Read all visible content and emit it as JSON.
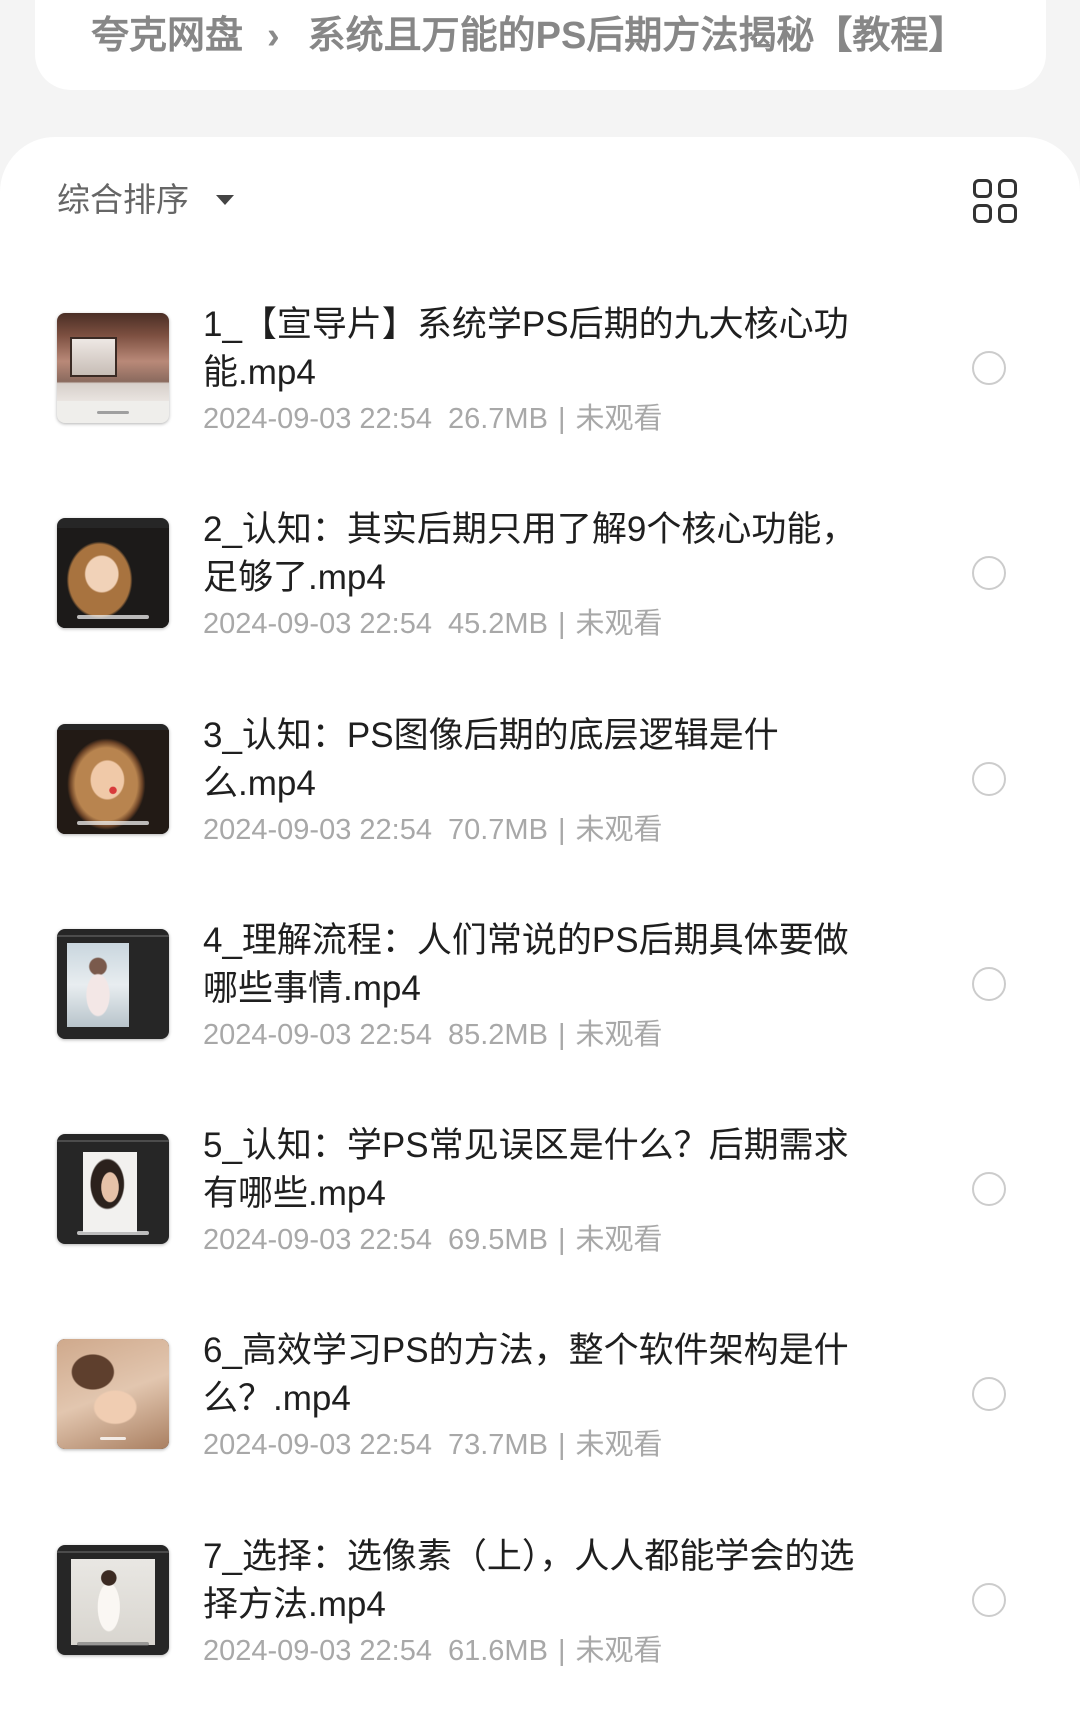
{
  "breadcrumb": {
    "root": "夸克网盘",
    "separator": "›",
    "current": "系统且万能的PS后期方法揭秘【教程】"
  },
  "toolbar": {
    "sort_label": "综合排序",
    "sort_icon": "caret-down-icon",
    "view_toggle_icon": "grid-view-icon"
  },
  "list": {
    "meta_separator": "|",
    "select_icon": "radio-circle-icon"
  },
  "files": [
    {
      "title": "1_【宣导片】系统学PS后期的九大核心功能.mp4",
      "date": "2024-09-03 22:54",
      "size": "26.7MB",
      "status": "未观看"
    },
    {
      "title": "2_认知：其实后期只用了解9个核心功能，足够了.mp4",
      "date": "2024-09-03 22:54",
      "size": "45.2MB",
      "status": "未观看"
    },
    {
      "title": "3_认知：PS图像后期的底层逻辑是什么.mp4",
      "date": "2024-09-03 22:54",
      "size": "70.7MB",
      "status": "未观看"
    },
    {
      "title": "4_理解流程：人们常说的PS后期具体要做哪些事情.mp4",
      "date": "2024-09-03 22:54",
      "size": "85.2MB",
      "status": "未观看"
    },
    {
      "title": "5_认知：学PS常见误区是什么？后期需求有哪些.mp4",
      "date": "2024-09-03 22:54",
      "size": "69.5MB",
      "status": "未观看"
    },
    {
      "title": "6_高效学习PS的方法，整个软件架构是什么？.mp4",
      "date": "2024-09-03 22:54",
      "size": "73.7MB",
      "status": "未观看"
    },
    {
      "title": "7_选择：选像素（上），人人都能学会的选择方法.mp4",
      "date": "2024-09-03 22:54",
      "size": "61.6MB",
      "status": "未观看"
    }
  ],
  "colors": {
    "page_background": "#f4f4f4",
    "card_background": "#ffffff",
    "title_text": "#1f1f1f",
    "meta_text": "#a8a8a8",
    "breadcrumb_text": "#878787"
  }
}
